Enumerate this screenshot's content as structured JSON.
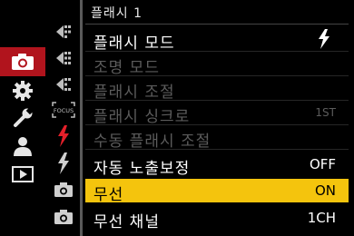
{
  "header": {
    "title": "플래시 1"
  },
  "categories": [
    {
      "icon": "camera-icon",
      "active": true
    },
    {
      "icon": "gear-icon",
      "active": false
    },
    {
      "icon": "wrench-icon",
      "active": false
    },
    {
      "icon": "person-icon",
      "active": false
    },
    {
      "icon": "playback-icon",
      "active": false
    }
  ],
  "subtabs": [
    {
      "icon": "photo-settings-1-icon"
    },
    {
      "icon": "photo-settings-2-icon"
    },
    {
      "icon": "photo-settings-3-icon"
    },
    {
      "icon": "focus-icon",
      "text": "FOCUS"
    },
    {
      "icon": "flash-icon",
      "active": true
    },
    {
      "icon": "flash-2-icon"
    },
    {
      "icon": "camera-mode-1-icon"
    },
    {
      "icon": "camera-mode-2-icon"
    }
  ],
  "menu": [
    {
      "label": "플래시 모드",
      "value_icon": "flash-bolt-icon",
      "disabled": false
    },
    {
      "label": "조명 모드",
      "value": "",
      "disabled": true
    },
    {
      "label": "플래시 조절",
      "value": "",
      "disabled": true
    },
    {
      "label": "플래시 싱크로",
      "value": "1ST",
      "disabled": true
    },
    {
      "label": "수동 플래시 조절",
      "value": "",
      "disabled": true
    },
    {
      "label": "자동 노출보정",
      "value": "OFF",
      "disabled": false
    },
    {
      "label": "무선",
      "value": "ON",
      "disabled": false,
      "selected": true
    },
    {
      "label": "무선 채널",
      "value": "1CH",
      "disabled": false
    }
  ],
  "colors": {
    "accent_red": "#b1141d",
    "highlight_yellow": "#f4c40d",
    "disabled_gray": "#5c5c5c"
  }
}
